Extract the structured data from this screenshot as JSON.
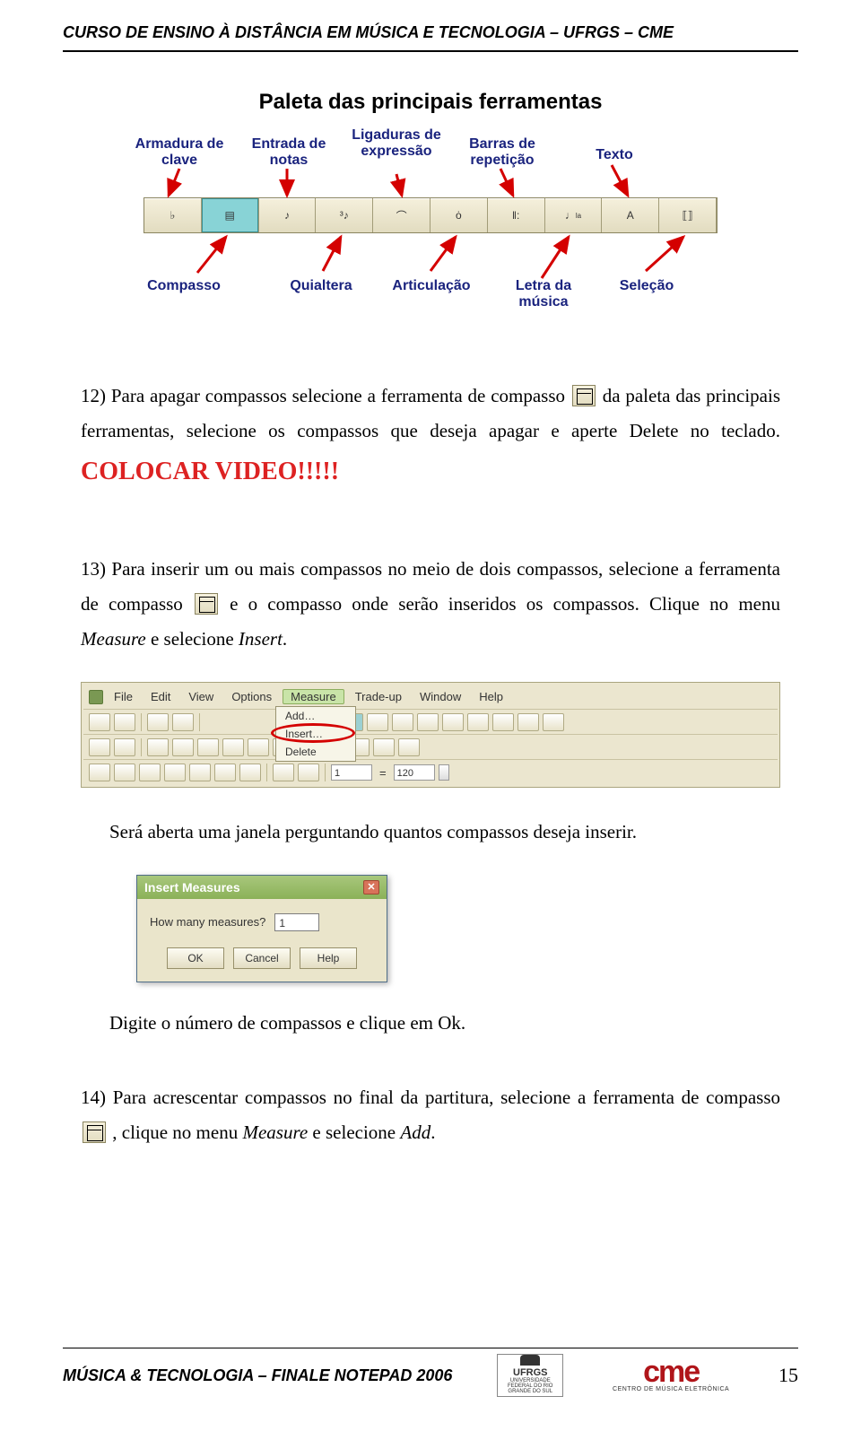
{
  "header": "CURSO DE ENSINO À DISTÂNCIA EM MÚSICA E TECNOLOGIA – UFRGS – CME",
  "diagram": {
    "title": "Paleta das principais ferramentas",
    "top_labels": [
      "Armadura de clave",
      "Entrada de notas",
      "Ligaduras de expressão",
      "Barras de repetição",
      "Texto"
    ],
    "bottom_labels": [
      "Compasso",
      "Quialtera",
      "Articulação",
      "Letra da música",
      "Seleção"
    ]
  },
  "p12": {
    "lead": "12) Para apagar compassos selecione a ferramenta de compasso ",
    "tail1": " da paleta das principais ferramentas, selecione os compassos que deseja apagar e aperte Delete no teclado. ",
    "colocar": "COLOCAR VIDEO!!!!!"
  },
  "p13": {
    "lead": "13) Para inserir um ou mais compassos no meio de dois compassos, selecione a ferramenta de compasso ",
    "tail1": " e o compasso onde serão inseridos os compassos. Clique no menu ",
    "m1": "Measure",
    "mid": " e selecione ",
    "m2": "Insert",
    "end": "."
  },
  "menubar": {
    "file": "File",
    "edit": "Edit",
    "view": "View",
    "options": "Options",
    "measure": "Measure",
    "tradeup": "Trade-up",
    "window": "Window",
    "help": "Help",
    "dd_add": "Add…",
    "dd_insert": "Insert…",
    "dd_delete": "Delete",
    "input1": "1",
    "eq": "=",
    "input2": "120"
  },
  "p13b": "Será aberta uma janela perguntando quantos compassos deseja inserir.",
  "dialog": {
    "title": "Insert Measures",
    "question": "How many measures?",
    "value": "1",
    "ok": "OK",
    "cancel": "Cancel",
    "help": "Help"
  },
  "p13c": "Digite o número de compassos e clique em Ok.",
  "p14": {
    "lead": "14) Para acrescentar compassos no final da partitura, selecione a ferramenta de compasso ",
    "tail1": ", clique no menu ",
    "m1": "Measure",
    "mid": " e selecione ",
    "m2": "Add",
    "end": "."
  },
  "footer": {
    "left": "MÚSICA & TECNOLOGIA – FINALE NOTEPAD 2006",
    "ufrgs_top": "UFRGS",
    "ufrgs_sub": "UNIVERSIDADE FEDERAL DO RIO GRANDE DO SUL",
    "cme": "cme",
    "cme_sub": "CENTRO  DE  MÚSICA  ELETRÔNICA",
    "page": "15"
  }
}
